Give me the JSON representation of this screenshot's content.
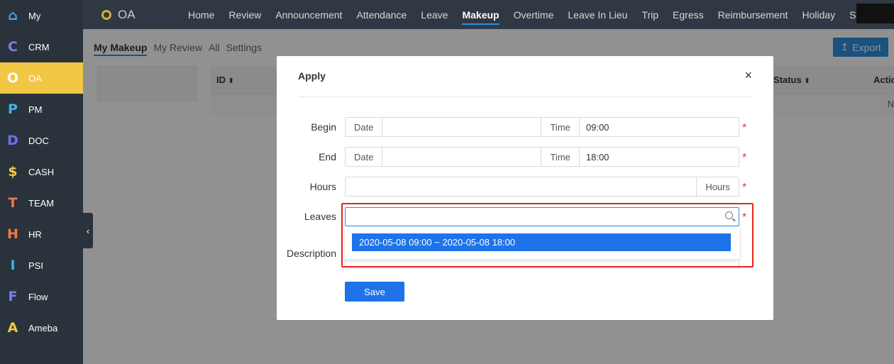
{
  "sidebar": {
    "items": [
      {
        "letter": "⌂",
        "label": "My",
        "color": "#4aa3df"
      },
      {
        "letter": "C",
        "label": "CRM",
        "color": "#7b7fe8"
      },
      {
        "letter": "O",
        "label": "OA",
        "color": "#ffffff"
      },
      {
        "letter": "P",
        "label": "PM",
        "color": "#3ab4f2"
      },
      {
        "letter": "D",
        "label": "DOC",
        "color": "#6d6ff0"
      },
      {
        "letter": "$",
        "label": "CASH",
        "color": "#f2c746"
      },
      {
        "letter": "T",
        "label": "TEAM",
        "color": "#f07b3f"
      },
      {
        "letter": "H",
        "label": "HR",
        "color": "#f07b3f"
      },
      {
        "letter": "I",
        "label": "PSI",
        "color": "#3ab4f2"
      },
      {
        "letter": "F",
        "label": "Flow",
        "color": "#7b7fe8"
      },
      {
        "letter": "A",
        "label": "Ameba",
        "color": "#f2c746"
      }
    ],
    "active_index": 2,
    "collapse_glyph": "‹"
  },
  "topnav": {
    "brand": "OA",
    "items": [
      "Home",
      "Review",
      "Announcement",
      "Attendance",
      "Leave",
      "Makeup",
      "Overtime",
      "Leave In Lieu",
      "Trip",
      "Egress",
      "Reimbursement",
      "Holiday",
      "S"
    ],
    "active": "Makeup"
  },
  "main": {
    "subtabs": [
      "My Makeup",
      "My Review",
      "All",
      "Settings"
    ],
    "active_subtab": "My Makeup",
    "export_label": "Export",
    "export_icon": "↥",
    "table": {
      "id_col": "ID",
      "status_col": "Status",
      "action_col": "Actio",
      "row_text": "N"
    }
  },
  "modal": {
    "title": "Apply",
    "close": "×",
    "begin": {
      "label": "Begin",
      "date_addon": "Date",
      "date_value": "",
      "time_addon": "Time",
      "time_value": "09:00"
    },
    "end": {
      "label": "End",
      "date_addon": "Date",
      "date_value": "",
      "time_addon": "Time",
      "time_value": "18:00"
    },
    "hours": {
      "label": "Hours",
      "value": "",
      "addon": "Hours"
    },
    "leaves": {
      "label": "Leaves",
      "value": "",
      "options": [
        "2020-05-08 09:00 ~ 2020-05-08 18:00"
      ]
    },
    "description": {
      "label": "Description"
    },
    "required_mark": "*",
    "save_label": "Save"
  }
}
